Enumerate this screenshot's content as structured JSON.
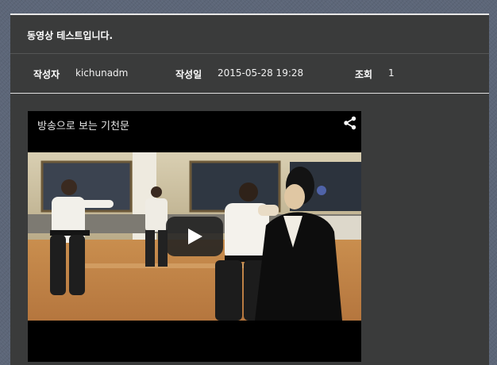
{
  "post": {
    "title": "동영상 테스트입니다.",
    "author_label": "작성자",
    "author": "kichunadm",
    "date_label": "작성일",
    "date": "2015-05-28 19:28",
    "views_label": "조회",
    "views": "1"
  },
  "video": {
    "title": "방송으로 보는 기천문",
    "icons": {
      "share": "share-icon",
      "play": "play-icon"
    }
  },
  "colors": {
    "panel": "#3a3b3b",
    "accent_line": "#e8e8e8",
    "page_bg": "#5c6678",
    "text": "#ffffff"
  }
}
